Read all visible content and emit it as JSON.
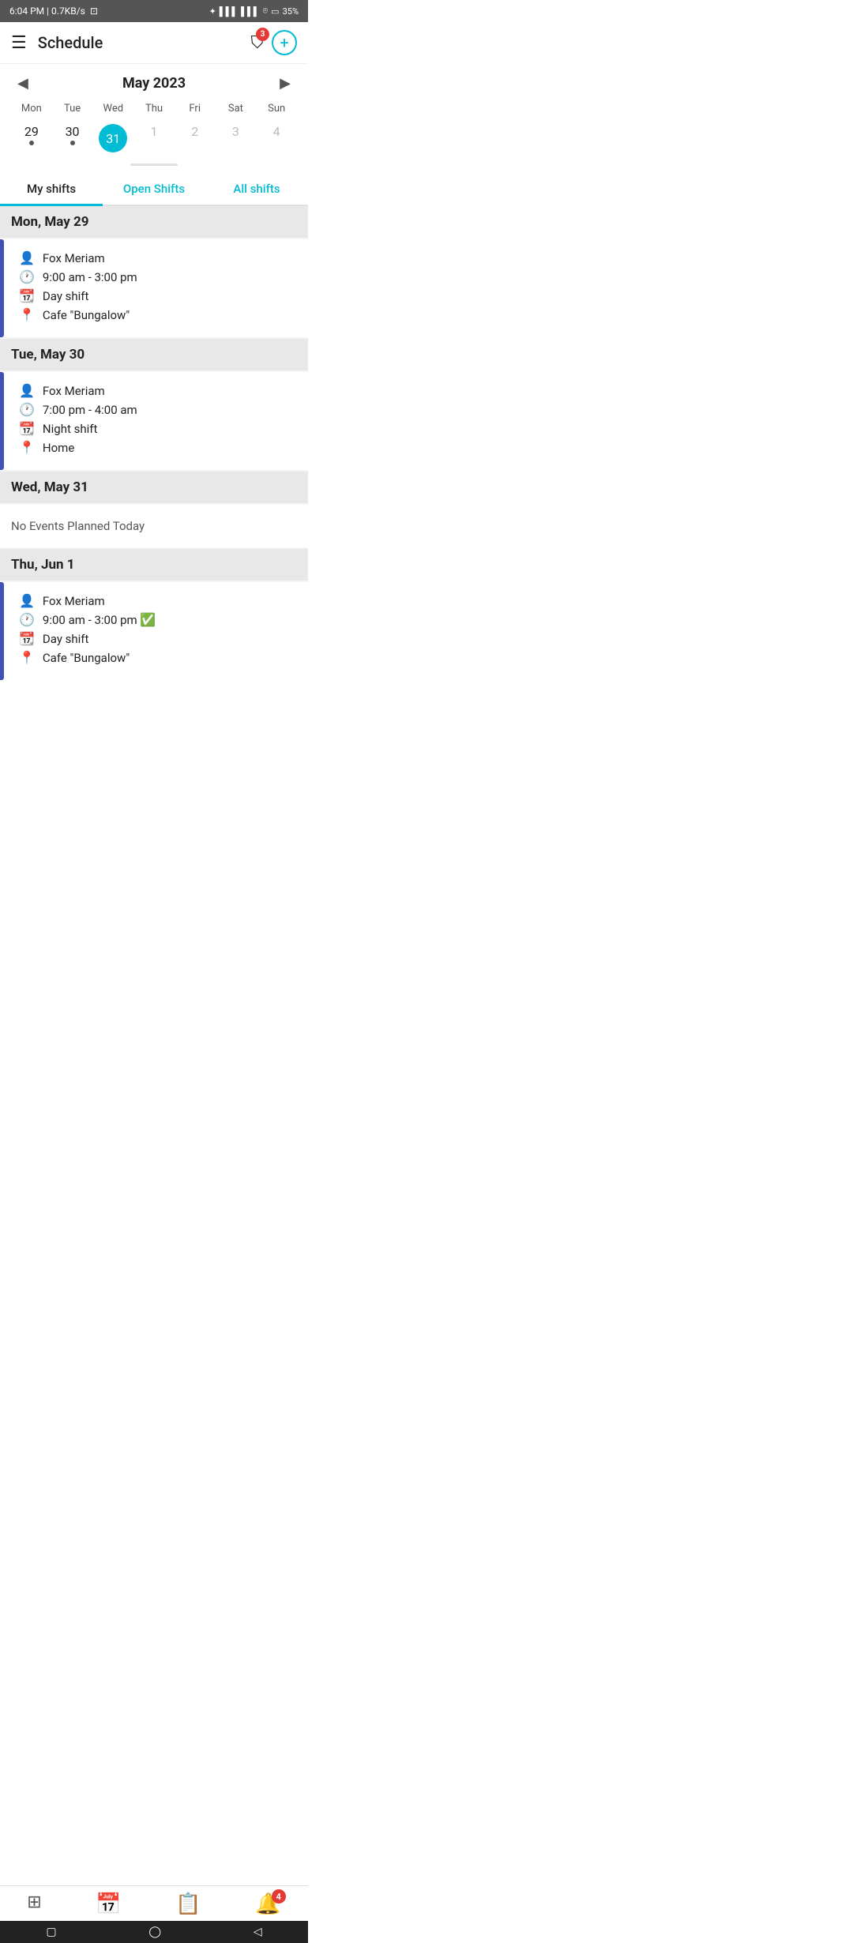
{
  "statusBar": {
    "time": "6:04 PM | 0.7KB/s",
    "battery": "35%"
  },
  "appBar": {
    "title": "Schedule",
    "filterBadge": "3"
  },
  "calendar": {
    "month": "May 2023",
    "weekdays": [
      "Mon",
      "Tue",
      "Wed",
      "Thu",
      "Fri",
      "Sat",
      "Sun"
    ],
    "days": [
      {
        "num": "29",
        "hasDot": true,
        "today": false,
        "otherMonth": false
      },
      {
        "num": "30",
        "hasDot": true,
        "today": false,
        "otherMonth": false
      },
      {
        "num": "31",
        "hasDot": false,
        "today": true,
        "otherMonth": false
      },
      {
        "num": "1",
        "hasDot": false,
        "today": false,
        "otherMonth": true
      },
      {
        "num": "2",
        "hasDot": false,
        "today": false,
        "otherMonth": true
      },
      {
        "num": "3",
        "hasDot": false,
        "today": false,
        "otherMonth": true
      },
      {
        "num": "4",
        "hasDot": false,
        "today": false,
        "otherMonth": true
      }
    ]
  },
  "tabs": [
    {
      "label": "My shifts",
      "active": true,
      "cyan": false
    },
    {
      "label": "Open Shifts",
      "active": false,
      "cyan": true
    },
    {
      "label": "All shifts",
      "active": false,
      "cyan": true
    }
  ],
  "days": [
    {
      "header": "Mon, May 29",
      "noEvents": false,
      "shifts": [
        {
          "person": "Fox Meriam",
          "time": "9:00 am - 3:00 pm",
          "type": "Day shift",
          "location": "Cafe \"Bungalow\"",
          "confirmed": false
        }
      ]
    },
    {
      "header": "Tue, May 30",
      "noEvents": false,
      "shifts": [
        {
          "person": "Fox Meriam",
          "time": "7:00 pm - 4:00 am",
          "type": "Night shift",
          "location": "Home",
          "confirmed": false
        }
      ]
    },
    {
      "header": "Wed, May 31",
      "noEvents": true,
      "noEventsText": "No Events Planned Today",
      "shifts": []
    },
    {
      "header": "Thu, Jun 1",
      "noEvents": false,
      "shifts": [
        {
          "person": "Fox Meriam",
          "time": "9:00 am - 3:00 pm",
          "type": "Day shift",
          "location": "Cafe \"Bungalow\"",
          "confirmed": true
        }
      ]
    }
  ],
  "bottomNav": [
    {
      "icon": "⊞",
      "label": "grid",
      "active": false
    },
    {
      "icon": "📅",
      "label": "calendar",
      "active": true
    },
    {
      "icon": "📋",
      "label": "clipboard",
      "active": false
    },
    {
      "icon": "🔔",
      "label": "notifications",
      "active": false,
      "badge": "4"
    }
  ]
}
